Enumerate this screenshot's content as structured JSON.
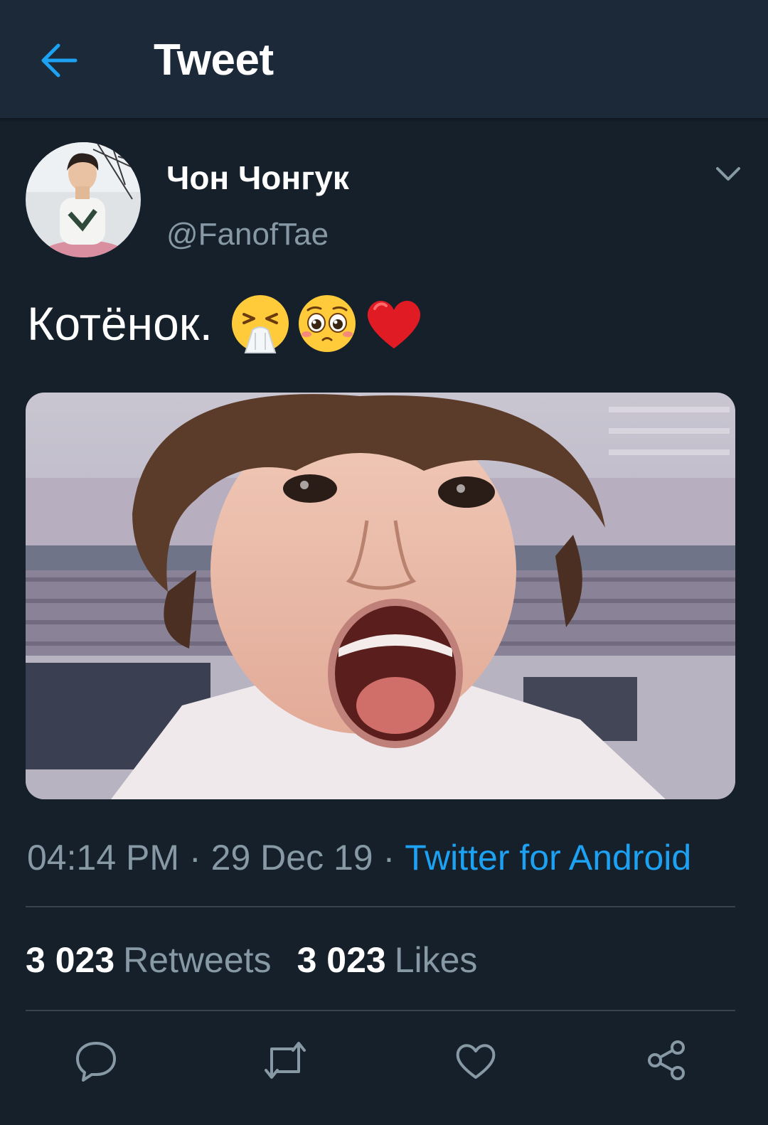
{
  "header": {
    "title": "Tweet",
    "back_icon": "arrow-left-icon",
    "accent_color": "#1da1f2"
  },
  "tweet": {
    "author": {
      "display_name": "Чон Чонгук",
      "handle": "@FanofTae"
    },
    "text": "Котёнок.",
    "emojis": [
      "crying-emoji",
      "pleading-face-emoji",
      "red-heart-emoji"
    ],
    "time": "04:14 PM",
    "date": "29 Dec 19",
    "separator": "·",
    "source": "Twitter for Android",
    "retweets_count": "3 023",
    "retweets_label": "Retweets",
    "likes_count": "3 023",
    "likes_label": "Likes"
  },
  "actions": [
    "reply-icon",
    "retweet-icon",
    "like-icon",
    "share-icon"
  ],
  "colors": {
    "background": "#15202b",
    "header_background": "#1c2938",
    "secondary_text": "#8899a6",
    "divider": "#38444d",
    "link": "#1da1f2"
  }
}
